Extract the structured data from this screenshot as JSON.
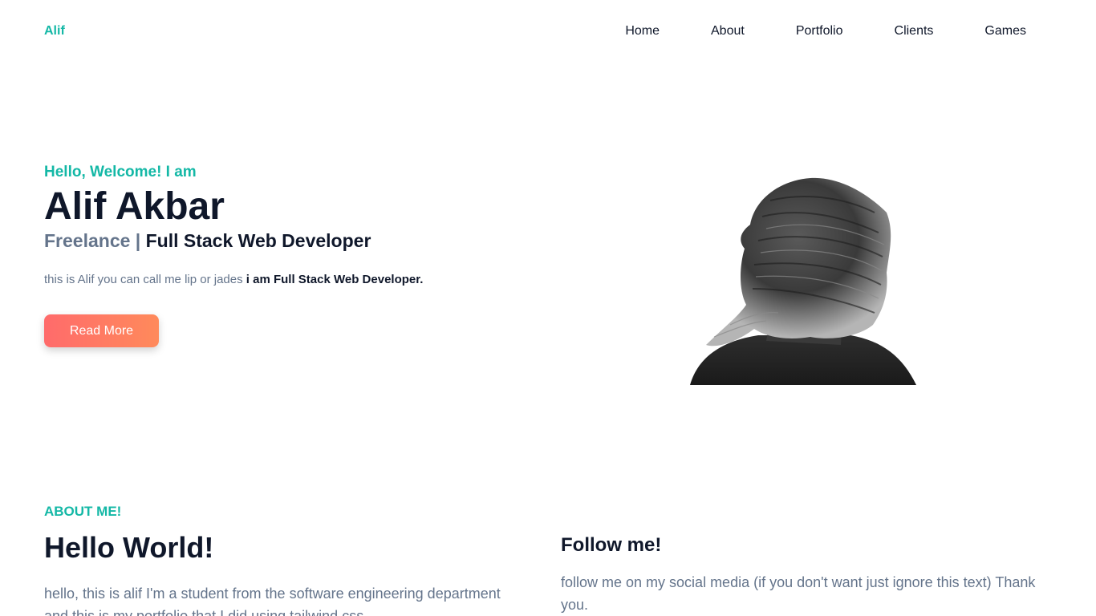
{
  "nav": {
    "logo": "Alif",
    "links": [
      "Home",
      "About",
      "Portfolio",
      "Clients",
      "Games"
    ]
  },
  "hero": {
    "greeting": "Hello, Welcome! I am",
    "name": "Alif Akbar",
    "role_prefix": "Freelance |",
    "role": "Full Stack Web Developer",
    "desc_plain": "this is Alif you can call me lip or jades",
    "desc_bold": "i am Full Stack Web Developer.",
    "button": "Read More",
    "photo_icon": "portrait-photo"
  },
  "about": {
    "tag": "ABOUT ME!",
    "title": "Hello World!",
    "text": "hello, this is alif I'm a student from the software engineering department and this is my portfolio that I did using tailwind css"
  },
  "follow": {
    "title": "Follow me!",
    "text": "follow me on my social media (if you don't want just ignore this text) Thank you."
  },
  "colors": {
    "accent": "#14b8a6",
    "heading": "#0f172a",
    "muted": "#64748b",
    "button_start": "#ff6b6b",
    "button_end": "#ff8a5b"
  }
}
